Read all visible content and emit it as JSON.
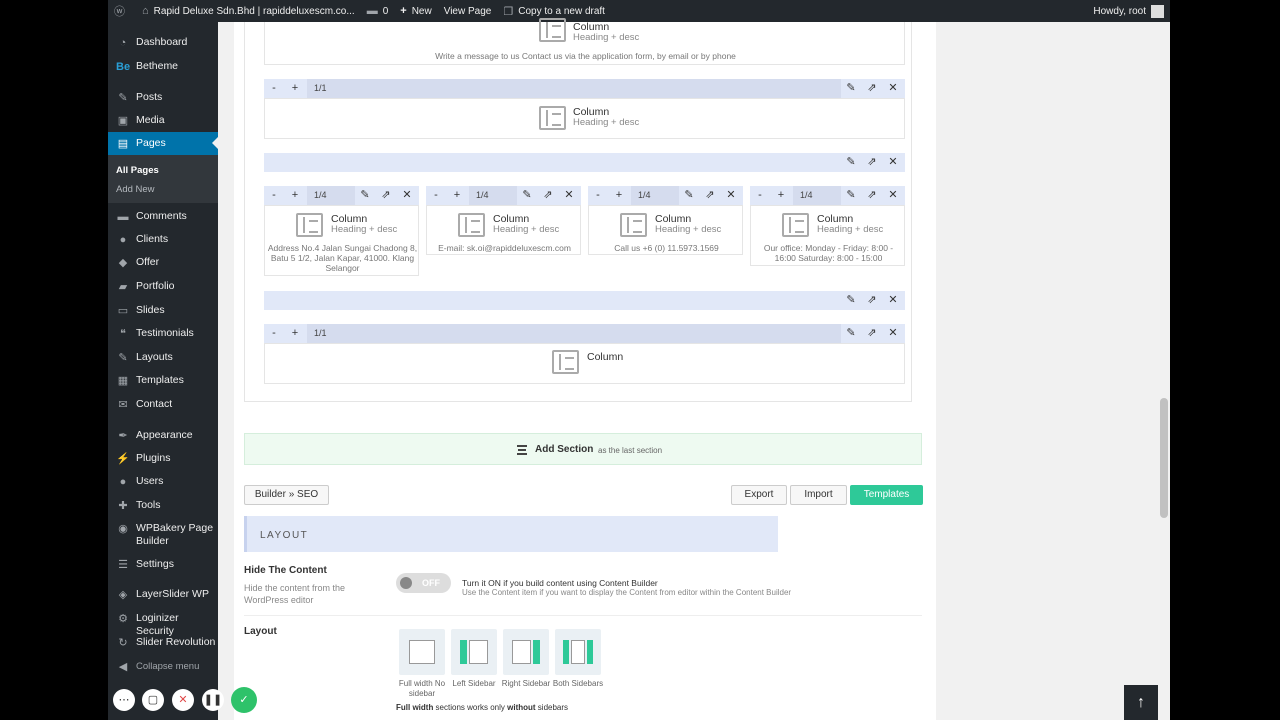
{
  "admin_bar": {
    "site_name": "Rapid Deluxe Sdn.Bhd | rapiddeluxescm.co...",
    "comments_count": "0",
    "new_label": "New",
    "view_page": "View Page",
    "copy_draft": "Copy to a new draft",
    "howdy": "Howdy, root"
  },
  "sidebar": {
    "items": [
      {
        "label": "Dashboard",
        "icon": "dashboard-icon"
      },
      {
        "label": "Betheme",
        "icon": "betheme-icon"
      },
      {
        "label": "Posts",
        "icon": "pin-icon"
      },
      {
        "label": "Media",
        "icon": "media-icon"
      },
      {
        "label": "Pages",
        "icon": "pages-icon"
      },
      {
        "label": "Comments",
        "icon": "comment-icon"
      },
      {
        "label": "Clients",
        "icon": "user-icon"
      },
      {
        "label": "Offer",
        "icon": "tag-icon"
      },
      {
        "label": "Portfolio",
        "icon": "folder-icon"
      },
      {
        "label": "Slides",
        "icon": "slides-icon"
      },
      {
        "label": "Testimonials",
        "icon": "quote-icon"
      },
      {
        "label": "Layouts",
        "icon": "layouts-icon"
      },
      {
        "label": "Templates",
        "icon": "templates-icon"
      },
      {
        "label": "Contact",
        "icon": "mail-icon"
      },
      {
        "label": "Appearance",
        "icon": "brush-icon"
      },
      {
        "label": "Plugins",
        "icon": "plugin-icon"
      },
      {
        "label": "Users",
        "icon": "users-icon"
      },
      {
        "label": "Tools",
        "icon": "wrench-icon"
      },
      {
        "label": "WPBakery Page Builder",
        "icon": "wpbakery-icon"
      },
      {
        "label": "Settings",
        "icon": "settings-icon"
      },
      {
        "label": "LayerSlider WP",
        "icon": "layers-icon"
      },
      {
        "label": "Loginizer Security",
        "icon": "gear-icon"
      },
      {
        "label": "Slider Revolution",
        "icon": "refresh-icon"
      },
      {
        "label": "Collapse menu",
        "icon": "collapse-icon"
      }
    ],
    "submenu": {
      "all_pages": "All Pages",
      "add_new": "Add New"
    }
  },
  "builder": {
    "top_item": {
      "title": "Column",
      "subtitle": "Heading + desc",
      "desc": "Write a message to us Contact us via the application form, by email or by phone"
    },
    "wrap1": {
      "size": "1/1",
      "item": {
        "title": "Column",
        "subtitle": "Heading + desc"
      }
    },
    "wrap2": {
      "columns": [
        {
          "size": "1/4",
          "title": "Column",
          "subtitle": "Heading + desc",
          "desc": "Address No.4 Jalan Sungai Chadong 8, Batu 5 1/2, Jalan Kapar, 41000. Klang Selangor"
        },
        {
          "size": "1/4",
          "title": "Column",
          "subtitle": "Heading + desc",
          "desc": "E-mail: sk.oi@rapiddeluxescm.com"
        },
        {
          "size": "1/4",
          "title": "Column",
          "subtitle": "Heading + desc",
          "desc": "Call us +6 (0) 11.5973.1569"
        },
        {
          "size": "1/4",
          "title": "Column",
          "subtitle": "Heading + desc",
          "desc": "Our office: Monday - Friday: 8:00 - 16:00 Saturday: 8:00 - 15:00"
        }
      ]
    },
    "wrap3": {
      "size": "1/1",
      "item": {
        "title": "Column"
      }
    },
    "controls": {
      "minus": "-",
      "plus": "+"
    }
  },
  "add_section": {
    "label": "Add Section",
    "sub": "as the last section"
  },
  "buttons": {
    "builder_seo": "Builder » SEO",
    "export": "Export",
    "import": "Import",
    "templates": "Templates"
  },
  "layout_section": {
    "heading": "LAYOUT",
    "hide_content": {
      "title": "Hide The Content",
      "desc": "Hide the content from the WordPress editor",
      "toggle": "OFF",
      "help1": "Turn it ON if you build content using Content Builder",
      "help2": "Use the Content item if you want to display the Content from editor within the Content Builder"
    },
    "layout": {
      "title": "Layout",
      "options": [
        "Full width No sidebar",
        "Left Sidebar",
        "Right Sidebar",
        "Both Sidebars"
      ],
      "note_bold1": "Full width",
      "note_mid": " sections works only ",
      "note_bold2": "without",
      "note_end": " sidebars"
    }
  }
}
